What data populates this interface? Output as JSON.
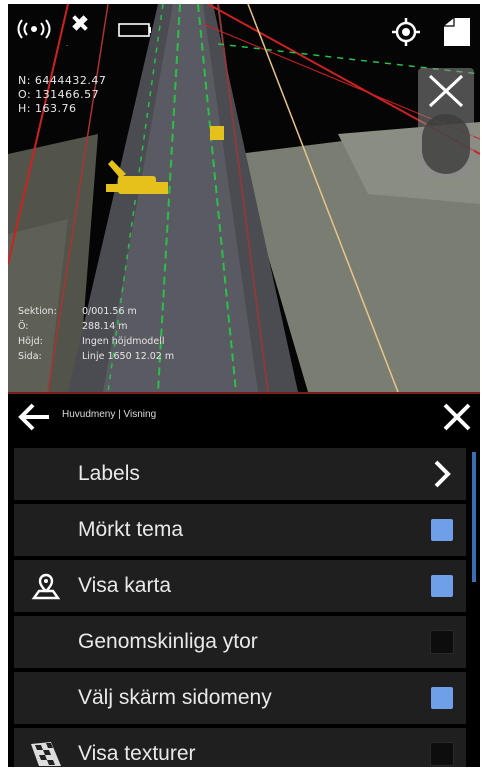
{
  "status_bar": {
    "gnss_icon": "antenna-broadcast-icon",
    "satellite_icon": "satellite-icon",
    "satellite_status": "-",
    "battery_icon": "battery-icon",
    "locate_icon": "crosshair-target-icon",
    "view_cube_icon": "view-cube-icon"
  },
  "coordinates": {
    "n": "N: 6444432.47",
    "e": "O: 131466.57",
    "h": "H: 163.76"
  },
  "measurements": [
    {
      "key": "Sektion:",
      "value": "0/001.56 m"
    },
    {
      "key": "Ö:",
      "value": "288.14 m"
    },
    {
      "key": "Höjd:",
      "value": "Ingen höjdmodell"
    },
    {
      "key": "Sida:",
      "value": "Linje 1650 12.02 m"
    }
  ],
  "menu": {
    "breadcrumb": "Huvudmeny | Visning",
    "items": [
      {
        "label": "Labels",
        "kind": "submenu",
        "icon": ""
      },
      {
        "label": "Mörkt tema",
        "kind": "checkbox",
        "checked": true,
        "icon": ""
      },
      {
        "label": "Visa karta",
        "kind": "checkbox",
        "checked": true,
        "icon": "map-pin-icon"
      },
      {
        "label": "Genomskinliga ytor",
        "kind": "checkbox",
        "checked": false,
        "icon": ""
      },
      {
        "label": "Välj skärm sidomeny",
        "kind": "checkbox",
        "checked": true,
        "icon": ""
      },
      {
        "label": "Visa texturer",
        "kind": "checkbox",
        "checked": false,
        "icon": "texture-flag-icon"
      }
    ]
  },
  "colors": {
    "checkbox_on": "#6f9fe8",
    "menu_row": "#1f1f1f",
    "accent_border": "#7a1c1c"
  }
}
